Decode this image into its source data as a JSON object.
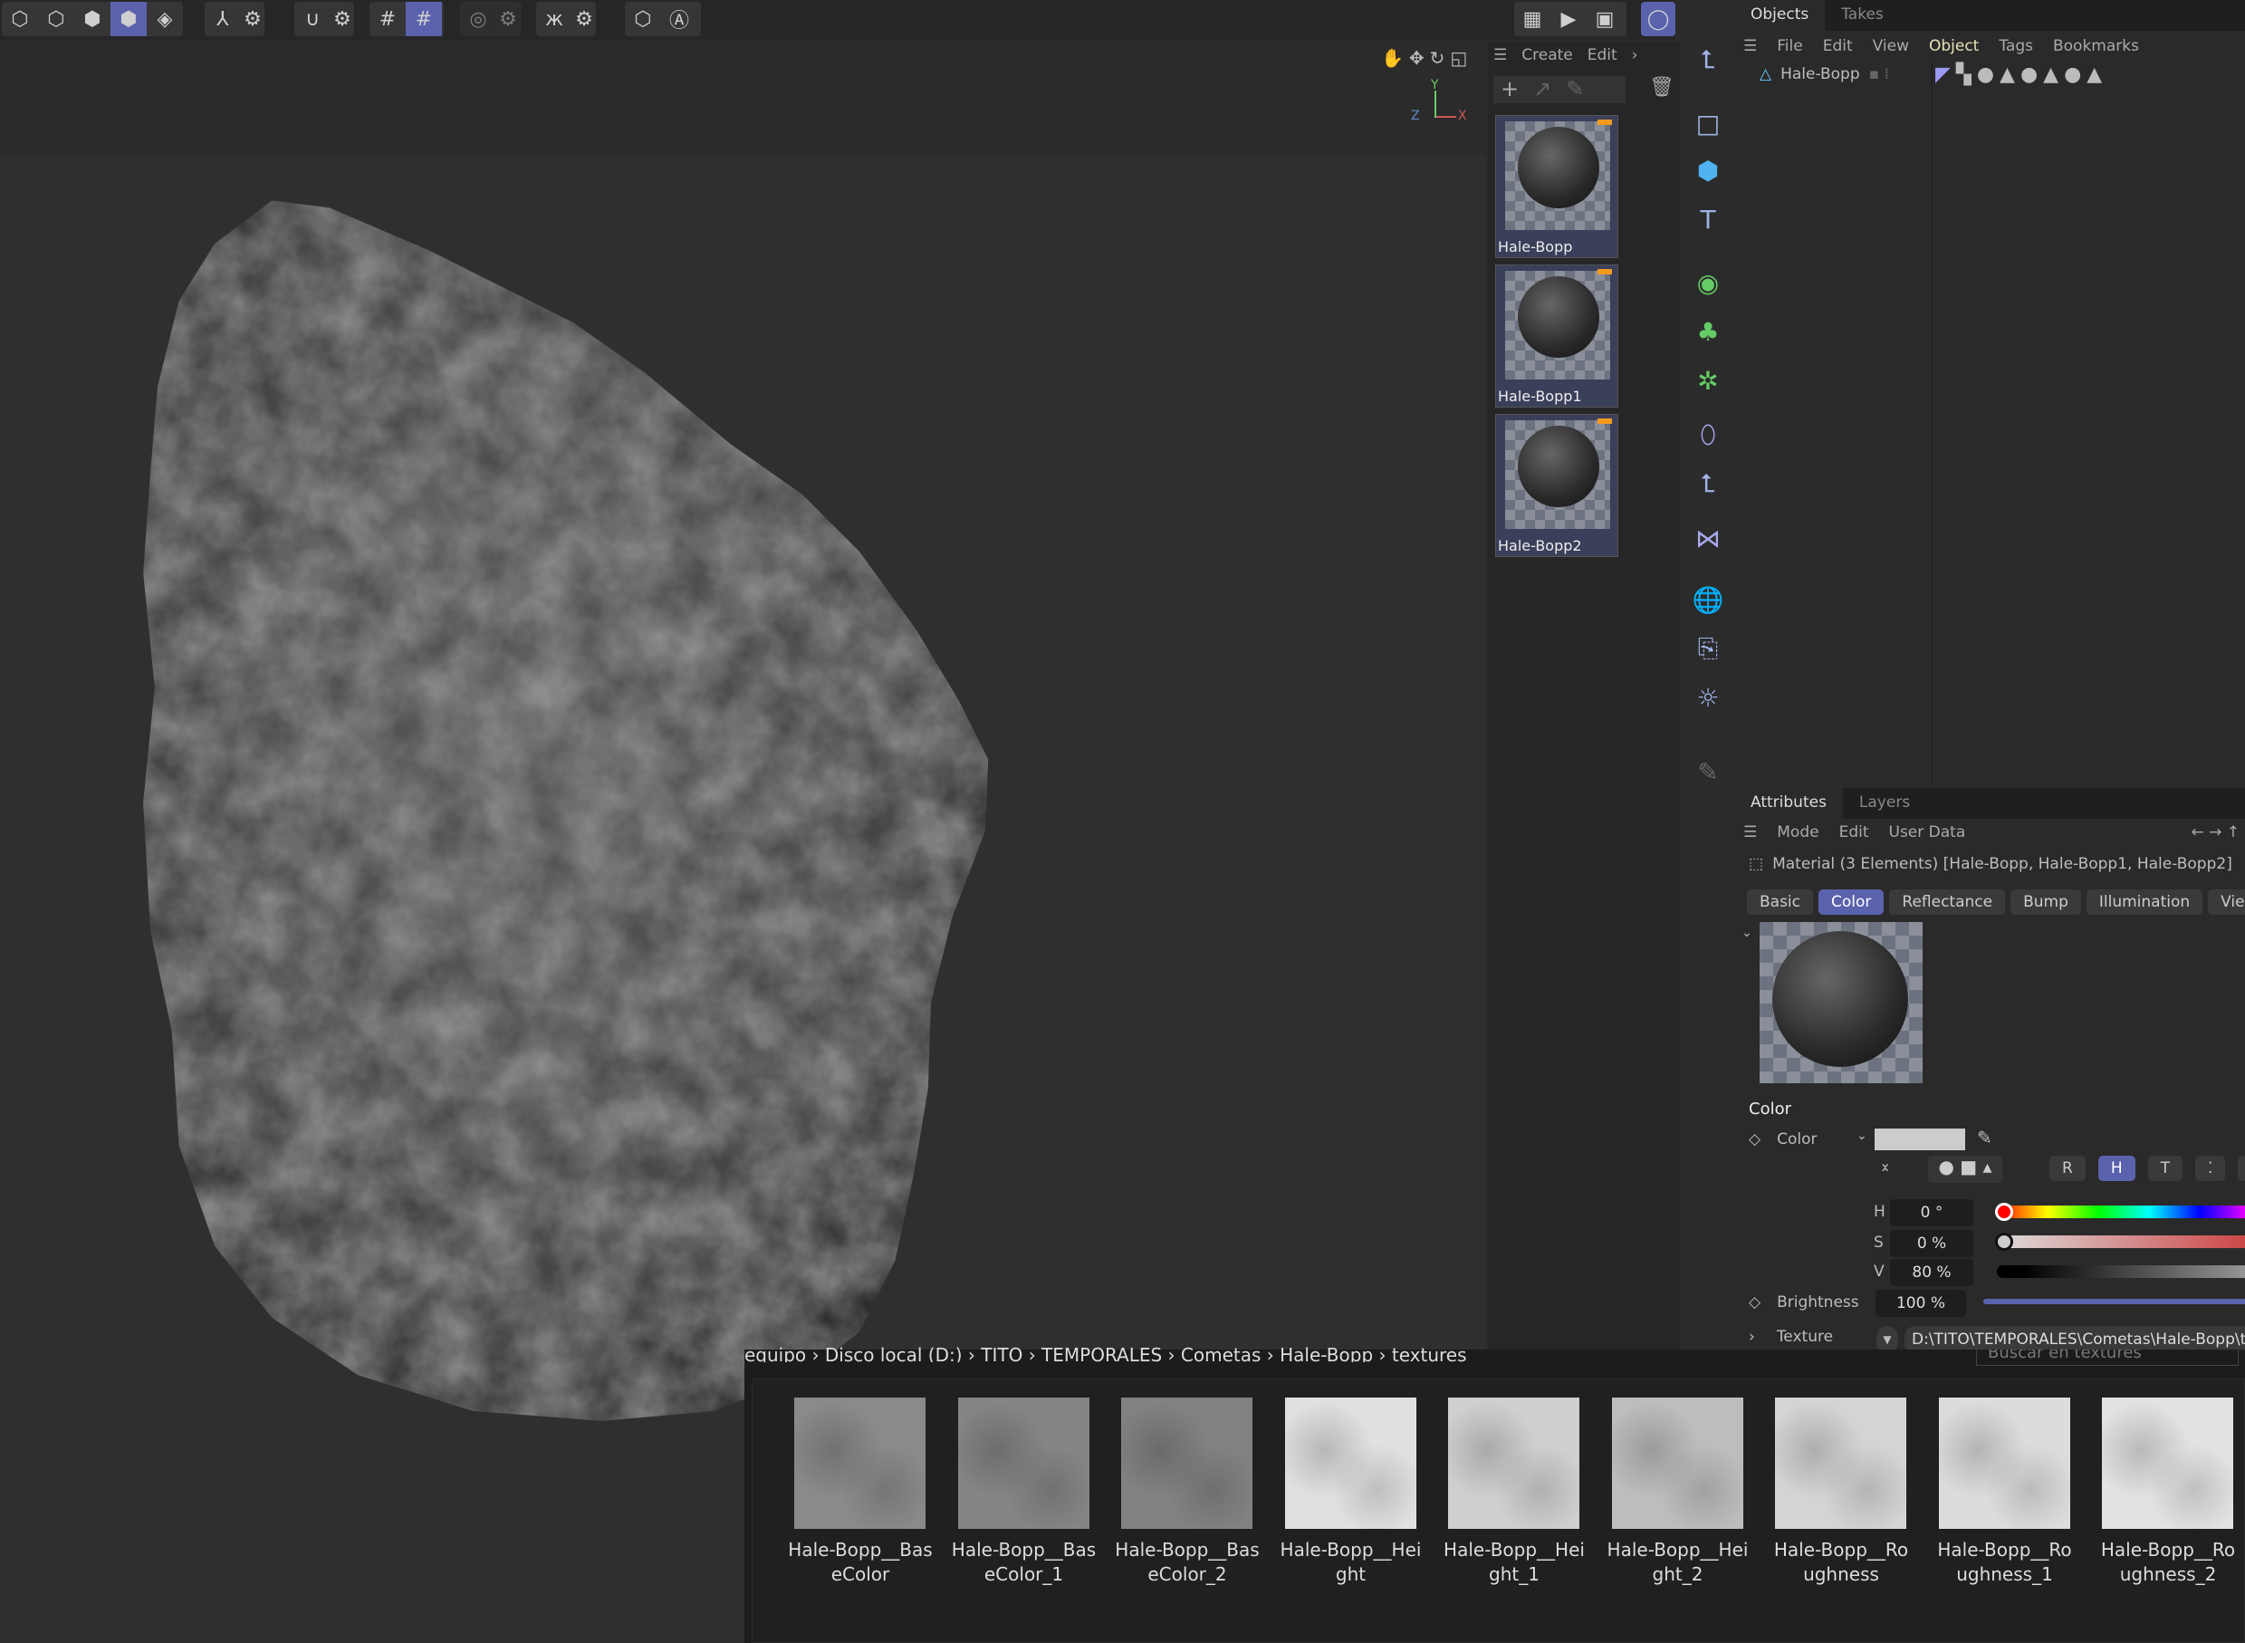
{
  "toolbar": {
    "icons": [
      "model-mode-icon",
      "points-mode-icon",
      "edges-mode-icon",
      "polygons-mode-icon",
      "uv-mode-icon",
      "axis-icon",
      "settings-icon",
      "snap-magnet-icon",
      "snap-settings-icon",
      "grid-icon",
      "grid-lock-icon",
      "soft-selection-icon",
      "soft-settings-icon",
      "symmetry-icon",
      "symmetry-settings-icon",
      "workplane-icon",
      "auto-icon"
    ],
    "active": [
      "polygons-mode-icon",
      "grid-lock-icon"
    ]
  },
  "viewport": {
    "axis_y": "Y",
    "axis_z": "Z",
    "axis_x": "X"
  },
  "material_manager": {
    "menu": [
      "Create",
      "Edit"
    ],
    "materials": [
      {
        "name": "Hale-Bopp"
      },
      {
        "name": "Hale-Bopp1"
      },
      {
        "name": "Hale-Bopp2"
      }
    ]
  },
  "objects": {
    "tabs": [
      "Objects",
      "Takes"
    ],
    "menu": [
      "File",
      "Edit",
      "View",
      "Object",
      "Tags",
      "Bookmarks"
    ],
    "tree": [
      {
        "name": "Hale-Bopp"
      }
    ]
  },
  "attributes": {
    "tabs": [
      "Attributes",
      "Layers"
    ],
    "menu": [
      "Mode",
      "Edit",
      "User Data"
    ],
    "title": "Material (3 Elements) [Hale-Bopp, Hale-Bopp1, Hale-Bopp2]",
    "subtabs": [
      "Basic",
      "Color",
      "Reflectance",
      "Bump",
      "Illumination",
      "Viewport"
    ],
    "active_subtab": "Color",
    "section": "Color",
    "color_label": "Color",
    "color_swatch": "#cccccc",
    "modes": [
      "R",
      "H",
      "T",
      "⁚",
      "#"
    ],
    "h_label": "H",
    "h_value": "0 °",
    "s_label": "S",
    "s_value": "0 %",
    "v_label": "V",
    "v_value": "80 %",
    "brightness_label": "Brightness",
    "brightness_value": "100 %",
    "brightness_fraction": 1.0,
    "texture_label": "Texture",
    "texture_path": "D:\\TITO\\TEMPORALES\\Cometas\\Hale-Bopp\\textures"
  },
  "browser": {
    "breadcrumb": "equipo  ›  Disco local (D:)  ›  TITO  ›  TEMPORALES  ›  Cometas  ›  Hale-Bopp  ›  textures",
    "search_placeholder": "Buscar en textures",
    "files": [
      {
        "l1": "Hale-Bopp__Bas",
        "l2": "eColor",
        "tone": "#8a8a8a"
      },
      {
        "l1": "Hale-Bopp__Bas",
        "l2": "eColor_1",
        "tone": "#858585"
      },
      {
        "l1": "Hale-Bopp__Bas",
        "l2": "eColor_2",
        "tone": "#828282"
      },
      {
        "l1": "Hale-Bopp__Hei",
        "l2": "ght",
        "tone": "#e0e0e0"
      },
      {
        "l1": "Hale-Bopp__Hei",
        "l2": "ght_1",
        "tone": "#cfcfcf"
      },
      {
        "l1": "Hale-Bopp__Hei",
        "l2": "ght_2",
        "tone": "#bdbdbd"
      },
      {
        "l1": "Hale-Bopp__Ro",
        "l2": "ughness",
        "tone": "#d4d4d4"
      },
      {
        "l1": "Hale-Bopp__Ro",
        "l2": "ughness_1",
        "tone": "#dcdcdc"
      },
      {
        "l1": "Hale-Bopp__Ro",
        "l2": "ughness_2",
        "tone": "#e2e2e2"
      }
    ]
  }
}
